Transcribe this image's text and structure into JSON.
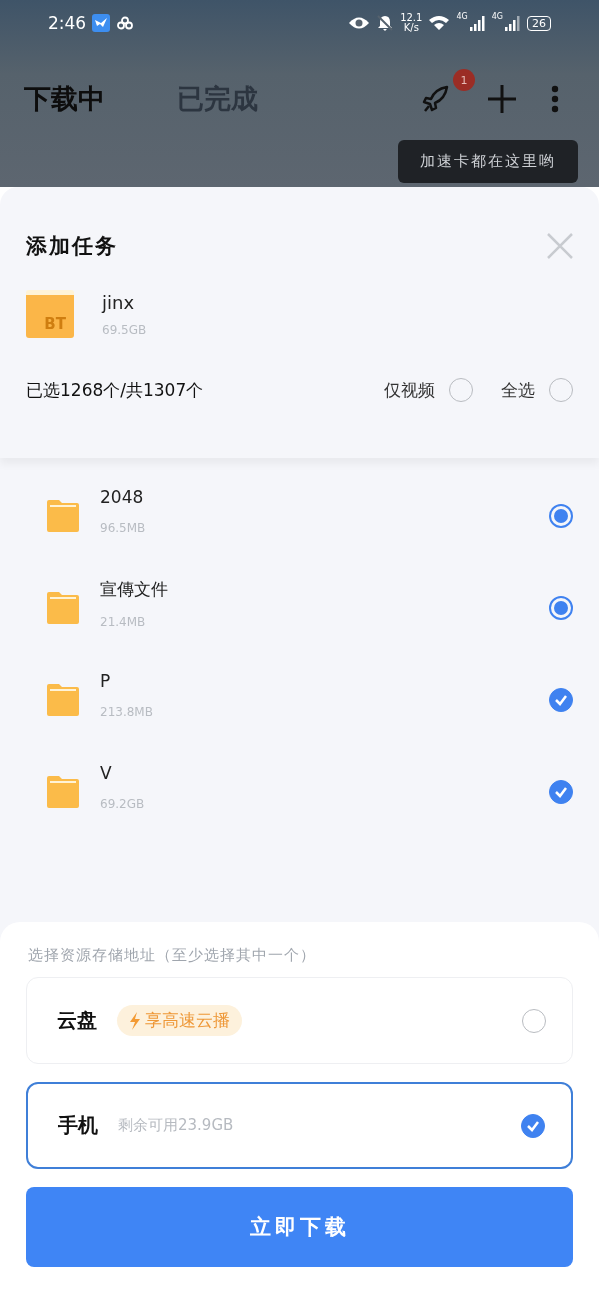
{
  "status_bar": {
    "time": "2:46",
    "speed": "12.1",
    "speed_unit": "K/s",
    "network_1": "4G",
    "network_2": "4G",
    "battery": "26"
  },
  "header": {
    "tabs": [
      {
        "label": "下载中",
        "selected": true
      },
      {
        "label": "已完成",
        "selected": false
      }
    ],
    "badge": "1",
    "tooltip": "加速卡都在这里哟"
  },
  "sheet": {
    "title": "添加任务",
    "torrent": {
      "name": "jinx",
      "size": "69.5GB",
      "badge": "BT"
    },
    "summary": "已选1268个/共1307个",
    "filters": [
      {
        "label": "仅视频",
        "checked": false
      },
      {
        "label": "全选",
        "checked": false
      }
    ],
    "items": [
      {
        "kind": "partial",
        "name": "2048",
        "size": "96.5MB",
        "checked": true
      },
      {
        "kind": "partial",
        "name": "宣傳文件",
        "size": "21.4MB",
        "checked": true
      },
      {
        "kind": "full",
        "name": "P",
        "size": "213.8MB",
        "checked": true
      },
      {
        "kind": "full",
        "name": "V",
        "size": "69.2GB",
        "checked": true
      }
    ]
  },
  "storage": {
    "hint": "选择资源存储地址（至少选择其中一个）",
    "options": [
      {
        "kind": "cloud",
        "label": "云盘",
        "tag": "享高速云播",
        "selected": false
      },
      {
        "kind": "phone",
        "label": "手机",
        "note": "剩余可用23.9GB",
        "selected": true
      }
    ],
    "button": "立即下载"
  }
}
